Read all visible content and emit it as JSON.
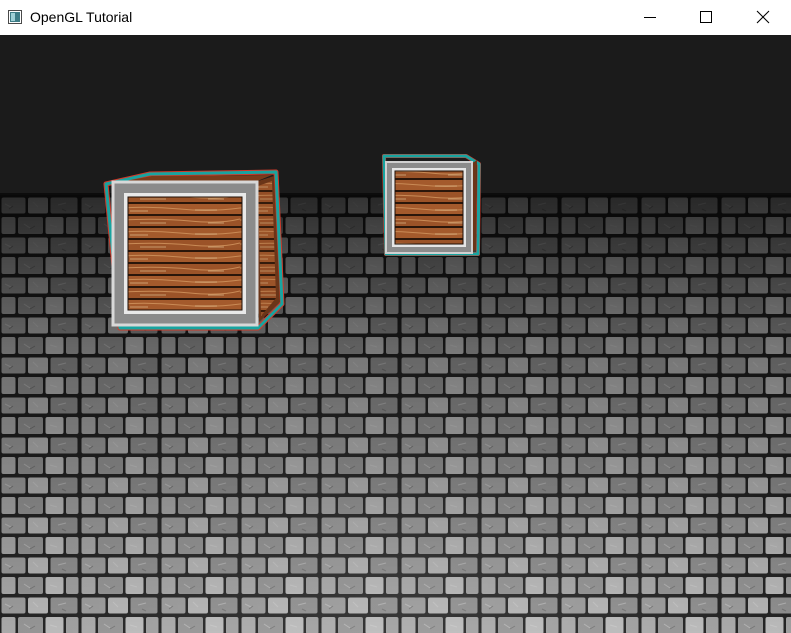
{
  "window": {
    "title": "OpenGL Tutorial",
    "controls": {
      "minimize_icon": "minimize-icon",
      "maximize_icon": "maximize-icon",
      "close_icon": "close-icon"
    }
  },
  "scene": {
    "background_color": "#1b1b1b",
    "objects": [
      {
        "type": "floor",
        "texture": "cobblestone"
      },
      {
        "type": "crate",
        "texture": "wooden-crate",
        "outline_color": "#18a4a0"
      },
      {
        "type": "crate",
        "texture": "wooden-crate",
        "outline_color": "#18a4a0"
      }
    ]
  }
}
